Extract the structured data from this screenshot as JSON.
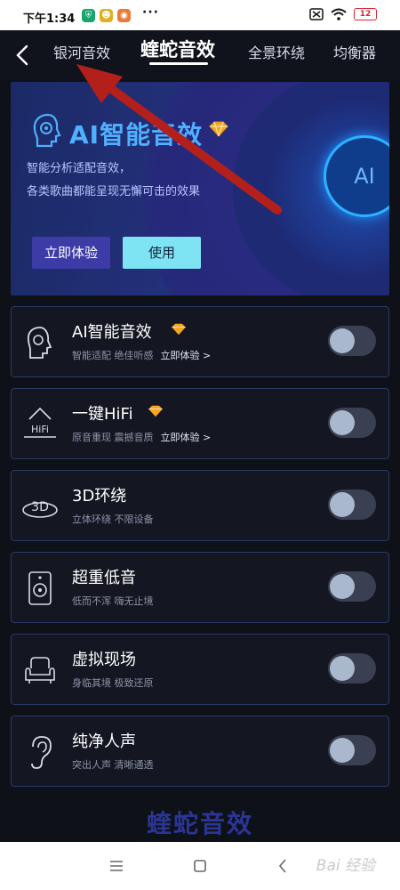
{
  "status_bar": {
    "time": "下午1:34",
    "dots": "···",
    "battery": "12"
  },
  "header": {
    "tabs": [
      {
        "label": "银河音效"
      },
      {
        "label": "蝰蛇音效"
      },
      {
        "label": "全景环绕"
      },
      {
        "label": "均衡器"
      }
    ],
    "active_tab": "蝰蛇音效"
  },
  "banner": {
    "title": "AI智能音效",
    "desc_line1": "智能分析适配音效，",
    "desc_line2": "各类歌曲都能呈现无懈可击的效果",
    "orb_label": "AI",
    "try_button": "立即体验",
    "use_button": "使用"
  },
  "effects": [
    {
      "title": "AI智能音效",
      "subtitle": "智能适配 绝佳听感",
      "link": "立即体验 >",
      "premium": true,
      "enabled": false,
      "icon": "ai-head-icon"
    },
    {
      "title": "一键HiFi",
      "subtitle": "原音重现 震撼音质",
      "link": "立即体验 >",
      "premium": true,
      "enabled": false,
      "icon": "hifi-icon"
    },
    {
      "title": "3D环绕",
      "subtitle": "立体环绕 不限设备",
      "link": "",
      "premium": false,
      "enabled": false,
      "icon": "3d-icon",
      "icon_text": "3D"
    },
    {
      "title": "超重低音",
      "subtitle": "低而不浑 嗨无止境",
      "link": "",
      "premium": false,
      "enabled": false,
      "icon": "speaker-icon"
    },
    {
      "title": "虚拟现场",
      "subtitle": "身临其境 极致还原",
      "link": "",
      "premium": false,
      "enabled": false,
      "icon": "sofa-icon"
    },
    {
      "title": "纯净人声",
      "subtitle": "突出人声 清晰通透",
      "link": "",
      "premium": false,
      "enabled": false,
      "icon": "ear-icon"
    }
  ],
  "hifi_icon_text": "HiFi",
  "footer_brand": "蝰蛇音效",
  "watermark": "Bai 经验",
  "colors": {
    "accent": "#4fb0ff",
    "gem": "#f5a623",
    "arrow": "#b3201c"
  }
}
